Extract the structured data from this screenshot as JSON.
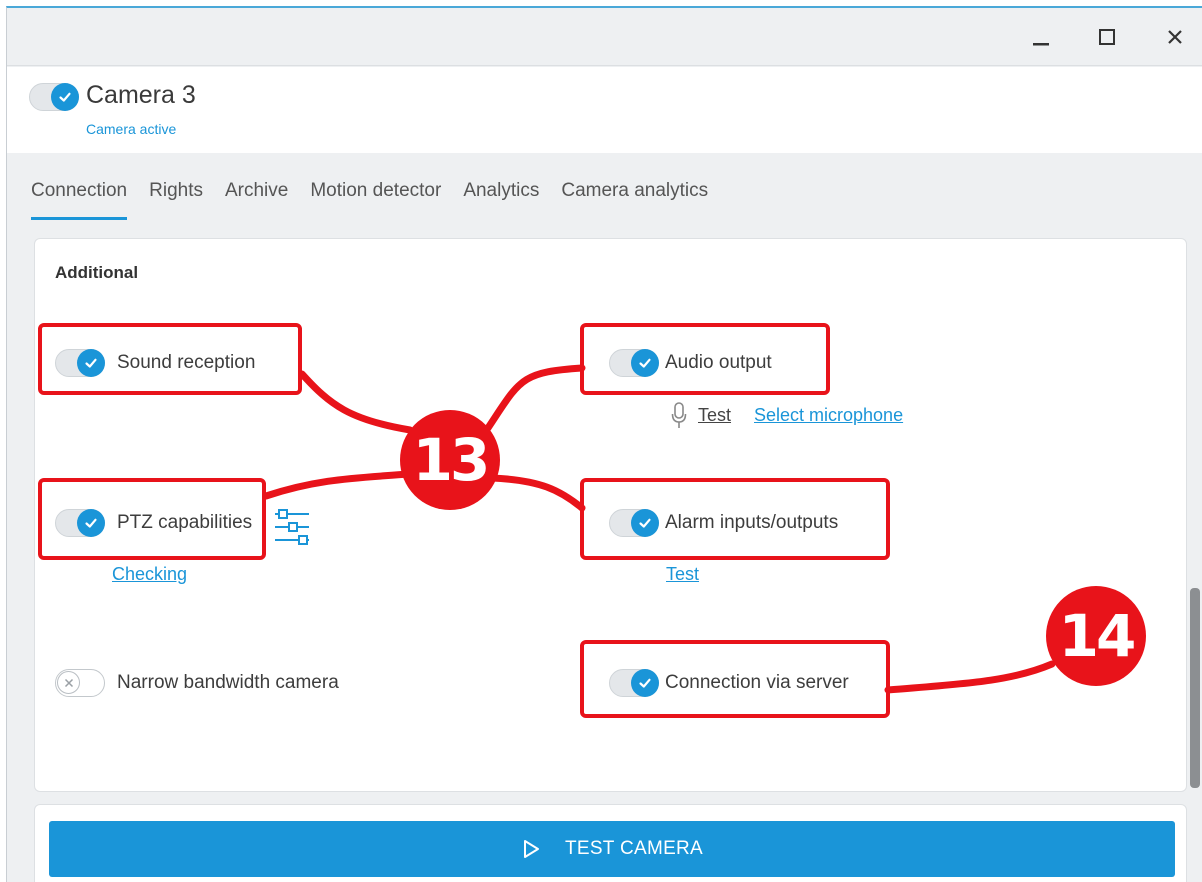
{
  "window": {
    "controls": {
      "minimize": "minimize-icon",
      "maximize": "maximize-icon",
      "close": "close-icon"
    }
  },
  "camera": {
    "name": "Camera 3",
    "status": "Camera active",
    "enabled": true
  },
  "tabs": [
    {
      "label": "Connection",
      "active": true
    },
    {
      "label": "Rights"
    },
    {
      "label": "Archive"
    },
    {
      "label": "Motion detector"
    },
    {
      "label": "Analytics"
    },
    {
      "label": "Camera analytics"
    }
  ],
  "section": {
    "title": "Additional",
    "options": {
      "sound_reception": {
        "label": "Sound reception",
        "checked": true
      },
      "audio_output": {
        "label": "Audio output",
        "checked": true,
        "test_link": "Test",
        "mic_link": "Select microphone"
      },
      "ptz": {
        "label": "PTZ capabilities",
        "checked": true,
        "link": "Checking"
      },
      "alarm_io": {
        "label": "Alarm inputs/outputs",
        "checked": true,
        "link": "Test"
      },
      "narrow_bandwidth": {
        "label": "Narrow bandwidth camera",
        "checked": false
      },
      "connection_via_server": {
        "label": "Connection via server",
        "checked": true
      }
    }
  },
  "annotations": {
    "badge_13": "13",
    "badge_14": "14"
  },
  "footer": {
    "test_button": "TEST CAMERA"
  },
  "colors": {
    "accent": "#1a95d8",
    "callout": "#e8131a"
  }
}
